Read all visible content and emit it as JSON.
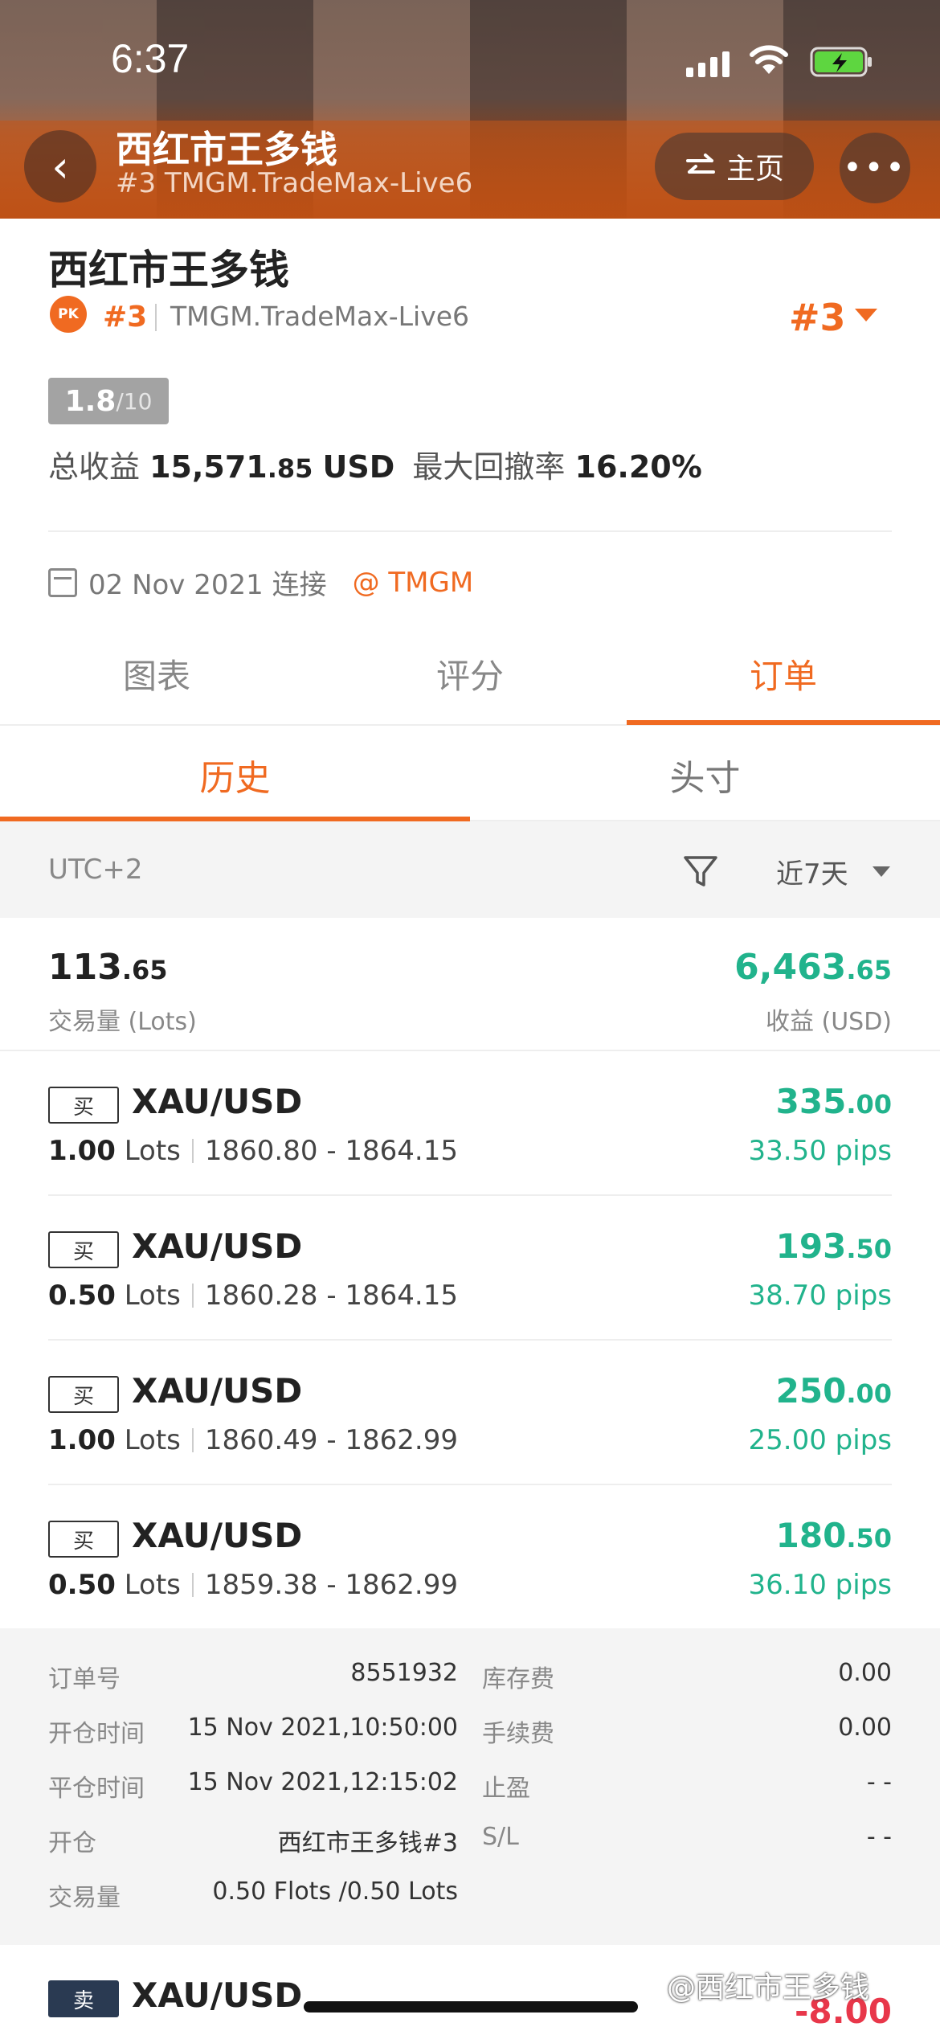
{
  "status_bar": {
    "time": "6:37"
  },
  "header": {
    "title": "西红市王多钱",
    "subtitle": "#3 TMGM.TradeMax-Live6",
    "home_label": "主页",
    "more_label": "•••",
    "back_label": "‹"
  },
  "profile": {
    "name": "西红市王多钱",
    "badge": "PK",
    "rank": "#3",
    "server": "TMGM.TradeMax-Live6",
    "rank_selector": "#3",
    "score": "1.8",
    "score_max": "/10",
    "total_profit_label": "总收益",
    "total_profit_int": "15,571",
    "total_profit_dec": ".85",
    "total_profit_unit": "USD",
    "max_drawdown_label": "最大回撤率",
    "max_drawdown": "16.20%",
    "connected": "02 Nov 2021 连接",
    "broker": "@ TMGM"
  },
  "tabs": [
    {
      "label": "图表",
      "active": false
    },
    {
      "label": "评分",
      "active": false
    },
    {
      "label": "订单",
      "active": true
    }
  ],
  "subtabs": [
    {
      "label": "历史",
      "active": true
    },
    {
      "label": "头寸",
      "active": false
    }
  ],
  "filter": {
    "timezone": "UTC+2",
    "range": "近7天"
  },
  "summary": {
    "volume_int": "113",
    "volume_dec": ".65",
    "volume_label": "交易量 (Lots)",
    "profit_int": "6,463",
    "profit_dec": ".65",
    "profit_label": "收益 (USD)"
  },
  "orders": [
    {
      "side": "买",
      "symbol": "XAU/USD",
      "lots": "1.00",
      "lots_unit": "Lots",
      "prices": "1860.80 - 1864.15",
      "profit_int": "335",
      "profit_dec": ".00",
      "pips": "33.50 pips"
    },
    {
      "side": "买",
      "symbol": "XAU/USD",
      "lots": "0.50",
      "lots_unit": "Lots",
      "prices": "1860.28 - 1864.15",
      "profit_int": "193",
      "profit_dec": ".50",
      "pips": "38.70 pips"
    },
    {
      "side": "买",
      "symbol": "XAU/USD",
      "lots": "1.00",
      "lots_unit": "Lots",
      "prices": "1860.49 - 1862.99",
      "profit_int": "250",
      "profit_dec": ".00",
      "pips": "25.00 pips"
    },
    {
      "side": "买",
      "symbol": "XAU/USD",
      "lots": "0.50",
      "lots_unit": "Lots",
      "prices": "1859.38 - 1862.99",
      "profit_int": "180",
      "profit_dec": ".50",
      "pips": "36.10 pips"
    }
  ],
  "details": {
    "order_no_label": "订单号",
    "order_no": "8551932",
    "open_time_label": "开仓时间",
    "open_time": "15 Nov 2021,10:50:00",
    "close_time_label": "平仓时间",
    "close_time": "15 Nov 2021,12:15:02",
    "open_label": "开仓",
    "open_by": "西红市王多钱#3",
    "volume_label": "交易量",
    "volume": "0.50 Flots /0.50 Lots",
    "swap_label": "库存费",
    "swap": "0.00",
    "commission_label": "手续费",
    "commission": "0.00",
    "tp_label": "止盈",
    "tp": "- -",
    "sl_label": "S/L",
    "sl": "- -"
  },
  "last_order": {
    "side": "卖",
    "symbol": "XAU/USD",
    "profit": "-8.00"
  },
  "watermark": "@西红市王多钱",
  "colors": {
    "accent": "#f06a21",
    "profit": "#21b38c",
    "loss": "#e8374a"
  }
}
